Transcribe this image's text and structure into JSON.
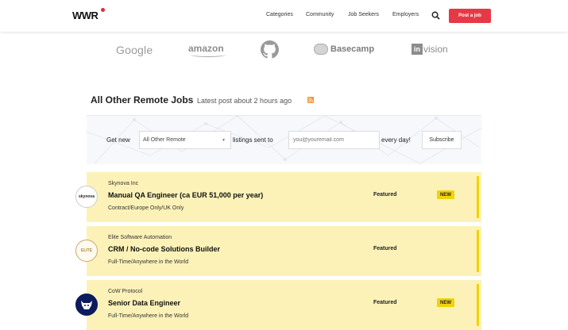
{
  "header": {
    "logo": "WWR",
    "nav": [
      "Categories",
      "Community",
      "Job Seekers",
      "Employers"
    ],
    "search_icon": "search-icon",
    "post_job_label": "Post a job",
    "accent": "#e63946"
  },
  "brands": {
    "google": "Google",
    "amazon": "amazon",
    "github": "github-icon",
    "basecamp": "Basecamp",
    "invision_mark": "in",
    "invision_rest": "vision"
  },
  "section": {
    "title": "All Other Remote Jobs",
    "latest_post": "Latest post about 2 hours ago",
    "rss_icon": "rss-icon"
  },
  "subscribe": {
    "get_new": "Get new",
    "category_value": "All Other Remote",
    "listings_sent_to": "listings sent to",
    "email_placeholder": "you@youremail.com",
    "every_day": "every day!",
    "button": "Subscribe"
  },
  "jobs": [
    {
      "company": "Skynova Inc",
      "logo_text": "skynova",
      "title": "Manual QA Engineer (ca EUR 51,000 per year)",
      "region": "Contract/Europe Only/UK Only",
      "featured": "Featured",
      "badge": "NEW"
    },
    {
      "company": "Elite Software Automation",
      "logo_text": "ELITE",
      "title": "CRM / No-code Solutions Builder",
      "region": "Full-Time/Anywhere in the World",
      "featured": "Featured",
      "badge": ""
    },
    {
      "company": "CoW Protocol",
      "logo_text": "cow-logo",
      "title": "Senior Data Engineer",
      "region": "Full-Time/Anywhere in the World",
      "featured": "Featured",
      "badge": "NEW"
    }
  ],
  "colors": {
    "job_bg": "#fcf2b8",
    "job_bar": "#f1d30a",
    "new_badge": "#f1d30a"
  }
}
